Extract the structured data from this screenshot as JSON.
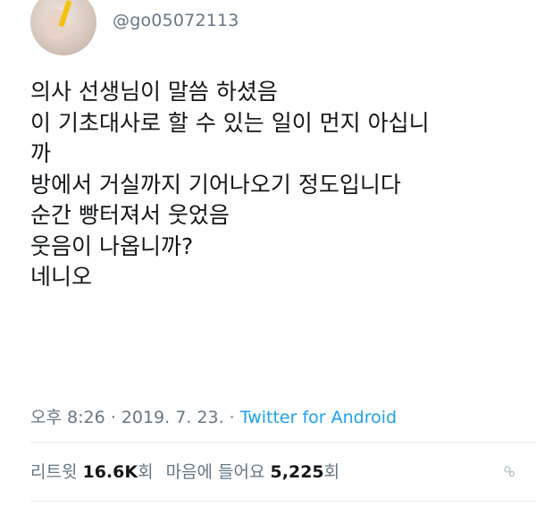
{
  "user": {
    "handle": "@go05072113"
  },
  "tweet": {
    "lines": [
      "의사 선생님이 말씀 하셨음",
      "이 기초대사로 할 수 있는 일이 먼지 아십니",
      "까",
      "방에서 거실까지 기어나오기 정도입니다",
      "순간 빵터져서 웃었음",
      "웃음이 나옵니까?",
      "네니오"
    ]
  },
  "meta": {
    "time": "오후 8:26",
    "sep1": " · ",
    "date": "2019. 7. 23.",
    "sep2": " · ",
    "source": "Twitter for Android"
  },
  "stats": {
    "retweet_label": "리트윗 ",
    "retweet_count": "16.6K",
    "retweet_unit": "회",
    "like_label": "마음에 들어요 ",
    "like_count": "5,225",
    "like_unit": "회"
  },
  "icons": {
    "avatar": "profile-photo",
    "faces": "liked-by-faces-icon"
  },
  "colors": {
    "text": "#14171a",
    "secondary": "#657786",
    "link": "#1da1f2",
    "divider": "#e6ecf0"
  }
}
